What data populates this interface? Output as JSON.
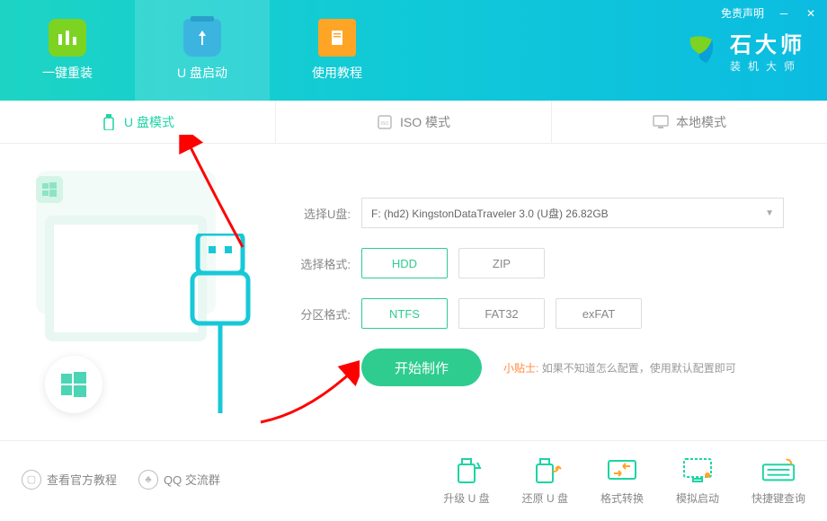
{
  "titlebar": {
    "disclaimer": "免责声明"
  },
  "nav": {
    "reinstall": "一键重装",
    "usb_boot": "U 盘启动",
    "tutorial": "使用教程"
  },
  "logo": {
    "title": "石大师",
    "subtitle": "装机大师"
  },
  "tabs": {
    "usb": "U 盘模式",
    "iso": "ISO 模式",
    "local": "本地模式"
  },
  "form": {
    "disk_label": "选择U盘:",
    "disk_value": "F: (hd2) KingstonDataTraveler 3.0 (U盘) 26.82GB",
    "format_label": "选择格式:",
    "format_options": {
      "hdd": "HDD",
      "zip": "ZIP"
    },
    "partition_label": "分区格式:",
    "partition_options": {
      "ntfs": "NTFS",
      "fat32": "FAT32",
      "exfat": "exFAT"
    },
    "start_button": "开始制作",
    "tip_label": "小贴士:",
    "tip_text": "如果不知道怎么配置，使用默认配置即可"
  },
  "bottom": {
    "official_tutorial": "查看官方教程",
    "qq_group": "QQ 交流群",
    "actions": {
      "upgrade": "升级 U 盘",
      "restore": "还原 U 盘",
      "convert": "格式转换",
      "simulate": "模拟启动",
      "hotkey": "快捷键查询"
    }
  }
}
